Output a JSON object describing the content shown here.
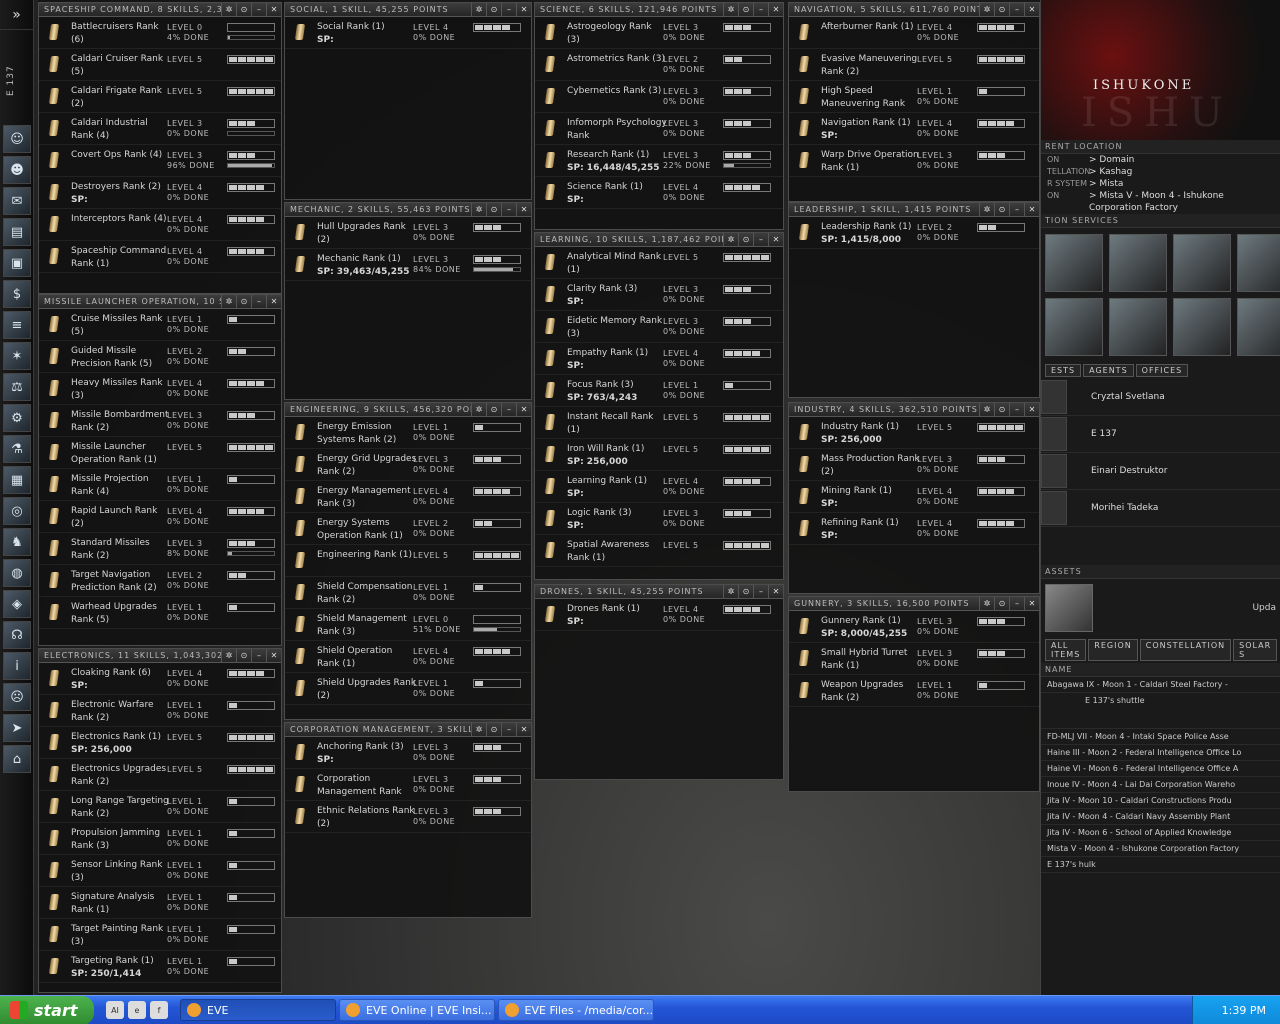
{
  "player": {
    "name": "E 137"
  },
  "neocom": {
    "icons": [
      "character-icon",
      "people-icon",
      "mail-icon",
      "notepad-icon",
      "assets-icon",
      "wallet-icon",
      "journal-icon",
      "map-icon",
      "market-icon",
      "industry-icon",
      "science-icon",
      "calculator-icon",
      "help-icon",
      "agents-icon",
      "browser-icon",
      "corp-icon",
      "headset-icon",
      "info-icon",
      "portrait-icon",
      "ship-icon",
      "hangar-icon"
    ]
  },
  "windows": [
    {
      "title": "SPACESHIP COMMAND, 8 SKILLS, 2,316",
      "skills": [
        {
          "name": "Battlecruisers Rank (6)",
          "level": "LEVEL 0",
          "done": "4% DONE",
          "lv": 0,
          "prog": 4
        },
        {
          "name": "Caldari Cruiser Rank (5)",
          "level": "LEVEL 5",
          "done": "",
          "lv": 5,
          "prog": null
        },
        {
          "name": "Caldari Frigate Rank (2)",
          "level": "LEVEL 5",
          "done": "",
          "lv": 5,
          "prog": null
        },
        {
          "name": "Caldari Industrial Rank (4)",
          "level": "LEVEL 3",
          "done": "0% DONE",
          "lv": 3,
          "prog": 0
        },
        {
          "name": "Covert Ops Rank (4)",
          "level": "LEVEL 3",
          "done": "96% DONE",
          "lv": 3,
          "prog": 96
        },
        {
          "name": "Destroyers Rank (2)",
          "sp": "SP:",
          "level": "LEVEL 4",
          "done": "0% DONE",
          "lv": 4,
          "prog": null
        },
        {
          "name": "Interceptors Rank (4)",
          "level": "LEVEL 4",
          "done": "0% DONE",
          "lv": 4,
          "prog": null
        },
        {
          "name": "Spaceship Command Rank (1)",
          "level": "LEVEL 4",
          "done": "0% DONE",
          "lv": 4,
          "prog": null
        }
      ]
    },
    {
      "title": "MISSILE LAUNCHER OPERATION, 10 SKIL",
      "skills": [
        {
          "name": "Cruise Missiles Rank (5)",
          "level": "LEVEL 1",
          "done": "0% DONE",
          "lv": 1,
          "prog": null
        },
        {
          "name": "Guided Missile Precision Rank (5)",
          "level": "LEVEL 2",
          "done": "0% DONE",
          "lv": 2,
          "prog": null
        },
        {
          "name": "Heavy Missiles Rank (3)",
          "level": "LEVEL 4",
          "done": "0% DONE",
          "lv": 4,
          "prog": null
        },
        {
          "name": "Missile Bombardment Rank (2)",
          "level": "LEVEL 3",
          "done": "0% DONE",
          "lv": 3,
          "prog": null
        },
        {
          "name": "Missile Launcher Operation Rank (1)",
          "level": "LEVEL 5",
          "done": "",
          "lv": 5,
          "prog": null
        },
        {
          "name": "Missile Projection Rank (4)",
          "level": "LEVEL 1",
          "done": "0% DONE",
          "lv": 1,
          "prog": null
        },
        {
          "name": "Rapid Launch Rank (2)",
          "level": "LEVEL 4",
          "done": "0% DONE",
          "lv": 4,
          "prog": null
        },
        {
          "name": "Standard Missiles Rank (2)",
          "level": "LEVEL 3",
          "done": "8% DONE",
          "lv": 3,
          "prog": 8
        },
        {
          "name": "Target Navigation Prediction Rank (2)",
          "level": "LEVEL 2",
          "done": "0% DONE",
          "lv": 2,
          "prog": null
        },
        {
          "name": "Warhead Upgrades Rank (5)",
          "level": "LEVEL 1",
          "done": "0% DONE",
          "lv": 1,
          "prog": null
        }
      ]
    },
    {
      "title": "ELECTRONICS, 11 SKILLS, 1,043,302 P",
      "skills": [
        {
          "name": "Cloaking Rank (6)",
          "sp": "SP:",
          "level": "LEVEL 4",
          "done": "0% DONE",
          "lv": 4,
          "prog": null
        },
        {
          "name": "Electronic Warfare Rank (2)",
          "level": "LEVEL 1",
          "done": "0% DONE",
          "lv": 1,
          "prog": null
        },
        {
          "name": "Electronics Rank (1)",
          "sp": "SP:  256,000",
          "level": "LEVEL 5",
          "done": "",
          "lv": 5,
          "prog": null
        },
        {
          "name": "Electronics Upgrades Rank (2)",
          "level": "LEVEL 5",
          "done": "",
          "lv": 5,
          "prog": null
        },
        {
          "name": "Long Range Targeting Rank (2)",
          "level": "LEVEL 1",
          "done": "0% DONE",
          "lv": 1,
          "prog": null
        },
        {
          "name": "Propulsion Jamming Rank (3)",
          "level": "LEVEL 1",
          "done": "0% DONE",
          "lv": 1,
          "prog": null
        },
        {
          "name": "Sensor Linking Rank (3)",
          "level": "LEVEL 1",
          "done": "0% DONE",
          "lv": 1,
          "prog": null
        },
        {
          "name": "Signature Analysis Rank (1)",
          "level": "LEVEL 1",
          "done": "0% DONE",
          "lv": 1,
          "prog": null
        },
        {
          "name": "Target Painting Rank (3)",
          "level": "LEVEL 1",
          "done": "0% DONE",
          "lv": 1,
          "prog": null
        },
        {
          "name": "Targeting Rank (1)",
          "sp": "SP:  250/1,414",
          "level": "LEVEL 1",
          "done": "0% DONE",
          "lv": 1,
          "prog": null
        }
      ]
    },
    {
      "title": "SOCIAL, 1 SKILL, 45,255 POINTS",
      "skills": [
        {
          "name": "Social Rank (1)",
          "sp": "SP:",
          "level": "LEVEL 4",
          "done": "0% DONE",
          "lv": 4,
          "prog": null
        }
      ]
    },
    {
      "title": "MECHANIC, 2 SKILLS, 55,463 POINTS",
      "skills": [
        {
          "name": "Hull Upgrades Rank (2)",
          "level": "LEVEL 3",
          "done": "0% DONE",
          "lv": 3,
          "prog": null
        },
        {
          "name": "Mechanic Rank (1)",
          "sp": "SP:  39,463/45,255",
          "level": "LEVEL 3",
          "done": "84% DONE",
          "lv": 3,
          "prog": 84
        }
      ]
    },
    {
      "title": "ENGINEERING, 9 SKILLS, 456,320 POINT",
      "skills": [
        {
          "name": "Energy Emission Systems Rank (2)",
          "level": "LEVEL 1",
          "done": "0% DONE",
          "lv": 1,
          "prog": null
        },
        {
          "name": "Energy Grid Upgrades Rank (2)",
          "level": "LEVEL 3",
          "done": "0% DONE",
          "lv": 3,
          "prog": null
        },
        {
          "name": "Energy Management Rank (3)",
          "level": "LEVEL 4",
          "done": "0% DONE",
          "lv": 4,
          "prog": null
        },
        {
          "name": "Energy Systems Operation Rank (1)",
          "level": "LEVEL 2",
          "done": "0% DONE",
          "lv": 2,
          "prog": null
        },
        {
          "name": "Engineering Rank (1)",
          "level": "LEVEL 5",
          "done": "",
          "lv": 5,
          "prog": null
        },
        {
          "name": "Shield Compensation Rank (2)",
          "level": "LEVEL 1",
          "done": "0% DONE",
          "lv": 1,
          "prog": null
        },
        {
          "name": "Shield Management Rank (3)",
          "level": "LEVEL 0",
          "done": "51% DONE",
          "lv": 0,
          "prog": 51
        },
        {
          "name": "Shield Operation Rank (1)",
          "level": "LEVEL 4",
          "done": "0% DONE",
          "lv": 4,
          "prog": null
        },
        {
          "name": "Shield Upgrades Rank (2)",
          "level": "LEVEL 1",
          "done": "0% DONE",
          "lv": 1,
          "prog": null
        }
      ]
    },
    {
      "title": "CORPORATION MANAGEMENT, 3 SKILLS,",
      "skills": [
        {
          "name": "Anchoring Rank (3)",
          "sp": "SP:",
          "level": "LEVEL 3",
          "done": "0% DONE",
          "lv": 3,
          "prog": null
        },
        {
          "name": "Corporation Management Rank",
          "level": "LEVEL 3",
          "done": "0% DONE",
          "lv": 3,
          "prog": null
        },
        {
          "name": "Ethnic Relations Rank (2)",
          "level": "LEVEL 3",
          "done": "0% DONE",
          "lv": 3,
          "prog": null
        }
      ]
    },
    {
      "title": "SCIENCE, 6 SKILLS, 121,946 POINTS",
      "skills": [
        {
          "name": "Astrogeology Rank (3)",
          "level": "LEVEL 3",
          "done": "0% DONE",
          "lv": 3,
          "prog": null
        },
        {
          "name": "Astrometrics Rank (3)",
          "level": "LEVEL 2",
          "done": "0% DONE",
          "lv": 2,
          "prog": null
        },
        {
          "name": "Cybernetics Rank (3)",
          "level": "LEVEL 3",
          "done": "0% DONE",
          "lv": 3,
          "prog": null
        },
        {
          "name": "Infomorph Psychology Rank",
          "level": "LEVEL 3",
          "done": "0% DONE",
          "lv": 3,
          "prog": null
        },
        {
          "name": "Research Rank (1)",
          "sp": "SP:  16,448/45,255",
          "level": "LEVEL 3",
          "done": "22% DONE",
          "lv": 3,
          "prog": 22
        },
        {
          "name": "Science Rank (1)",
          "sp": "SP:",
          "level": "LEVEL 4",
          "done": "0% DONE",
          "lv": 4,
          "prog": null
        }
      ]
    },
    {
      "title": "LEARNING, 10 SKILLS, 1,187,462 POINT",
      "skills": [
        {
          "name": "Analytical Mind Rank (1)",
          "level": "LEVEL 5",
          "done": "",
          "lv": 5,
          "prog": null
        },
        {
          "name": "Clarity Rank (3)",
          "sp": "SP:",
          "level": "LEVEL 3",
          "done": "0% DONE",
          "lv": 3,
          "prog": null
        },
        {
          "name": "Eidetic Memory Rank (3)",
          "level": "LEVEL 3",
          "done": "0% DONE",
          "lv": 3,
          "prog": null
        },
        {
          "name": "Empathy Rank (1)",
          "sp": "SP:",
          "level": "LEVEL 4",
          "done": "0% DONE",
          "lv": 4,
          "prog": null
        },
        {
          "name": "Focus Rank (3)",
          "sp": "SP:  763/4,243",
          "level": "LEVEL 1",
          "done": "0% DONE",
          "lv": 1,
          "prog": null
        },
        {
          "name": "Instant Recall Rank (1)",
          "level": "LEVEL 5",
          "done": "",
          "lv": 5,
          "prog": null
        },
        {
          "name": "Iron Will Rank (1)",
          "sp": "SP:  256,000",
          "level": "LEVEL 5",
          "done": "",
          "lv": 5,
          "prog": null
        },
        {
          "name": "Learning Rank (1)",
          "sp": "SP:",
          "level": "LEVEL 4",
          "done": "0% DONE",
          "lv": 4,
          "prog": null
        },
        {
          "name": "Logic Rank (3)",
          "sp": "SP:",
          "level": "LEVEL 3",
          "done": "0% DONE",
          "lv": 3,
          "prog": null
        },
        {
          "name": "Spatial Awareness Rank (1)",
          "level": "LEVEL 5",
          "done": "",
          "lv": 5,
          "prog": null
        }
      ]
    },
    {
      "title": "DRONES, 1 SKILL, 45,255 POINTS",
      "skills": [
        {
          "name": "Drones Rank (1)",
          "sp": "SP:",
          "level": "LEVEL 4",
          "done": "0% DONE",
          "lv": 4,
          "prog": null
        }
      ]
    },
    {
      "title": "NAVIGATION, 5 SKILLS, 611,760 POINTS",
      "skills": [
        {
          "name": "Afterburner Rank (1)",
          "level": "LEVEL 4",
          "done": "0% DONE",
          "lv": 4,
          "prog": null
        },
        {
          "name": "Evasive Maneuvering Rank (2)",
          "level": "LEVEL 5",
          "done": "",
          "lv": 5,
          "prog": null
        },
        {
          "name": "High Speed Maneuvering Rank",
          "level": "LEVEL 1",
          "done": "0% DONE",
          "lv": 1,
          "prog": null
        },
        {
          "name": "Navigation Rank (1)",
          "sp": "SP:",
          "level": "LEVEL 4",
          "done": "0% DONE",
          "lv": 4,
          "prog": null
        },
        {
          "name": "Warp Drive Operation Rank (1)",
          "level": "LEVEL 3",
          "done": "0% DONE",
          "lv": 3,
          "prog": null
        }
      ]
    },
    {
      "title": "LEADERSHIP, 1 SKILL, 1,415 POINTS",
      "skills": [
        {
          "name": "Leadership Rank (1)",
          "sp": "SP:  1,415/8,000",
          "level": "LEVEL 2",
          "done": "0% DONE",
          "lv": 2,
          "prog": null
        }
      ]
    },
    {
      "title": "INDUSTRY, 4 SKILLS, 362,510 POINTS",
      "skills": [
        {
          "name": "Industry Rank (1)",
          "sp": "SP:  256,000",
          "level": "LEVEL 5",
          "done": "",
          "lv": 5,
          "prog": null
        },
        {
          "name": "Mass Production Rank (2)",
          "level": "LEVEL 3",
          "done": "0% DONE",
          "lv": 3,
          "prog": null
        },
        {
          "name": "Mining Rank (1)",
          "sp": "SP:",
          "level": "LEVEL 4",
          "done": "0% DONE",
          "lv": 4,
          "prog": null
        },
        {
          "name": "Refining Rank (1)",
          "sp": "SP:",
          "level": "LEVEL 4",
          "done": "0% DONE",
          "lv": 4,
          "prog": null
        }
      ]
    },
    {
      "title": "GUNNERY, 3 SKILLS, 16,500 POINTS",
      "skills": [
        {
          "name": "Gunnery Rank (1)",
          "sp": "SP:  8,000/45,255",
          "level": "LEVEL 3",
          "done": "0% DONE",
          "lv": 3,
          "prog": null
        },
        {
          "name": "Small Hybrid Turret Rank (1)",
          "level": "LEVEL 3",
          "done": "0% DONE",
          "lv": 3,
          "prog": null
        },
        {
          "name": "Weapon Upgrades Rank (2)",
          "level": "LEVEL 1",
          "done": "0% DONE",
          "lv": 1,
          "prog": null
        }
      ]
    }
  ],
  "right": {
    "logo": "ISHUKONE",
    "logo_bg": "ISHU",
    "loc_title": "RENT LOCATION",
    "loc": [
      {
        "k": "ON",
        "v": "> Domain"
      },
      {
        "k": "TELLATION",
        "v": "> Kashag"
      },
      {
        "k": "R SYSTEM",
        "v": "> Mista"
      },
      {
        "k": "ON",
        "v": "> Mista V - Moon 4 - Ishukone"
      },
      {
        "k": "",
        "v": "Corporation Factory"
      }
    ],
    "svc_title": "TION SERVICES",
    "tabs": [
      "ESTS",
      "AGENTS",
      "OFFICES"
    ],
    "agents": [
      "Cryztal Svetlana",
      "E 137",
      "Einari Destruktor",
      "Morihei Tadeka"
    ],
    "assets_title": "ASSETS",
    "update": "Upda",
    "asset_tabs": [
      "ALL ITEMS",
      "REGION",
      "CONSTELLATION",
      "SOLAR S"
    ],
    "col": "NAME",
    "assets": [
      "Abagawa IX - Moon 1 - Caldari Steel Factory - ",
      "E 137's shuttle",
      "FD-MLJ VII - Moon 4 - Intaki Space Police Asse",
      "Haine III - Moon 2 - Federal Intelligence Office Lo",
      "Haine VI - Moon 6 - Federal Intelligence Office A",
      "Inoue IV - Moon 4 - Lai Dai Corporation Wareho",
      "Jita IV - Moon 10 - Caldari Constructions Produ",
      "Jita IV - Moon 4 - Caldari Navy Assembly Plant",
      "Jita IV - Moon 6 - School of Applied Knowledge",
      "Mista V - Moon 4 - Ishukone Corporation Factory",
      "E 137's hulk"
    ]
  },
  "taskbar": {
    "start": "start",
    "tasks": [
      "EVE",
      "EVE Online | EVE Insi...",
      "EVE Files - /media/cor..."
    ],
    "time": "1:39 PM"
  }
}
